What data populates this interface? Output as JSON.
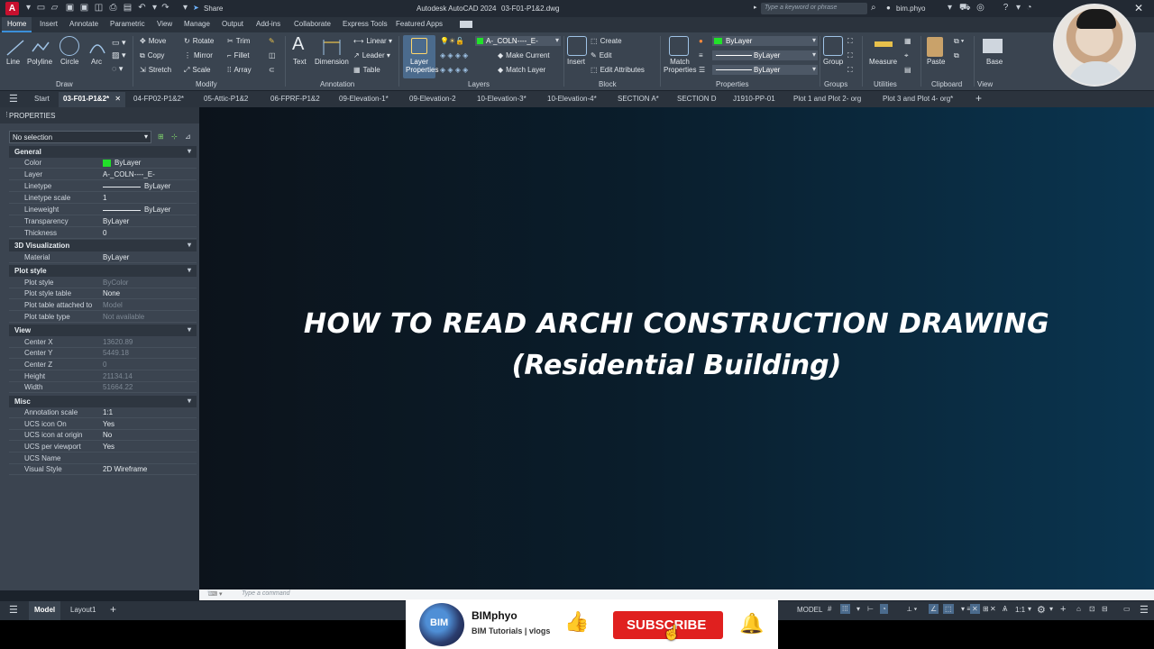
{
  "titlebar": {
    "share_label": "Share",
    "app_title": "Autodesk AutoCAD 2024",
    "file_name": "03-F01-P1&2.dwg",
    "search_placeholder": "Type a keyword or phrase",
    "user": "bim.phyo"
  },
  "ribbon_tabs": [
    "Home",
    "Insert",
    "Annotate",
    "Parametric",
    "View",
    "Manage",
    "Output",
    "Add-ins",
    "Collaborate",
    "Express Tools",
    "Featured Apps"
  ],
  "ribbon": {
    "draw": {
      "line": "Line",
      "polyline": "Polyline",
      "circle": "Circle",
      "arc": "Arc",
      "label": "Draw"
    },
    "modify": {
      "move": "Move",
      "rotate": "Rotate",
      "trim": "Trim",
      "copy": "Copy",
      "mirror": "Mirror",
      "fillet": "Fillet",
      "stretch": "Stretch",
      "scale": "Scale",
      "array": "Array",
      "label": "Modify"
    },
    "annotation": {
      "text": "Text",
      "dimension": "Dimension",
      "linear": "Linear",
      "leader": "Leader",
      "table": "Table",
      "label": "Annotation"
    },
    "layers": {
      "layer_properties": "Layer Properties",
      "current_layer": "A-_COLN----_E-",
      "make_current": "Make Current",
      "match_layer": "Match Layer",
      "label": "Layers"
    },
    "block": {
      "insert": "Insert",
      "create": "Create",
      "edit": "Edit",
      "edit_attributes": "Edit Attributes",
      "label": "Block"
    },
    "properties": {
      "match": "Match Properties",
      "color": "ByLayer",
      "lineweight": "ByLayer",
      "linetype": "ByLayer",
      "label": "Properties"
    },
    "groups": {
      "group": "Group",
      "label": "Groups"
    },
    "utilities": {
      "measure": "Measure",
      "label": "Utilities"
    },
    "clipboard": {
      "paste": "Paste",
      "label": "Clipboard"
    },
    "view": {
      "base": "Base",
      "label": "View"
    }
  },
  "doc_tabs": [
    "Start",
    "03-F01-P1&2*",
    "04-FP02-P1&2*",
    "05-Attic-P1&2",
    "06-FPRF-P1&2",
    "09-Elevation-1*",
    "09-Elevation-2",
    "10-Elevation-3*",
    "10-Elevation-4*",
    "SECTION A*",
    "SECTION D",
    "J1910-PP-01",
    "Plot 1 and Plot 2- org",
    "Plot 3 and Plot 4- org*"
  ],
  "properties_panel": {
    "header": "PROPERTIES",
    "selection": "No selection",
    "general": {
      "title": "General",
      "rows": [
        {
          "label": "Color",
          "value": "ByLayer"
        },
        {
          "label": "Layer",
          "value": "A-_COLN----_E-"
        },
        {
          "label": "Linetype",
          "value": "ByLayer"
        },
        {
          "label": "Linetype scale",
          "value": "1"
        },
        {
          "label": "Lineweight",
          "value": "ByLayer"
        },
        {
          "label": "Transparency",
          "value": "ByLayer"
        },
        {
          "label": "Thickness",
          "value": "0"
        }
      ]
    },
    "viz": {
      "title": "3D Visualization",
      "rows": [
        {
          "label": "Material",
          "value": "ByLayer"
        }
      ]
    },
    "plot": {
      "title": "Plot style",
      "rows": [
        {
          "label": "Plot style",
          "value": "ByColor"
        },
        {
          "label": "Plot style table",
          "value": "None"
        },
        {
          "label": "Plot table attached to",
          "value": "Model"
        },
        {
          "label": "Plot table type",
          "value": "Not available"
        }
      ]
    },
    "view": {
      "title": "View",
      "rows": [
        {
          "label": "Center X",
          "value": "13620.89"
        },
        {
          "label": "Center Y",
          "value": "5449.18"
        },
        {
          "label": "Center Z",
          "value": "0"
        },
        {
          "label": "Height",
          "value": "21134.14"
        },
        {
          "label": "Width",
          "value": "51664.22"
        }
      ]
    },
    "misc": {
      "title": "Misc",
      "rows": [
        {
          "label": "Annotation scale",
          "value": "1:1"
        },
        {
          "label": "UCS icon On",
          "value": "Yes"
        },
        {
          "label": "UCS icon at origin",
          "value": "No"
        },
        {
          "label": "UCS per viewport",
          "value": "Yes"
        },
        {
          "label": "UCS Name",
          "value": ""
        },
        {
          "label": "Visual Style",
          "value": "2D Wireframe"
        }
      ]
    }
  },
  "canvas": {
    "title_line1": "HOW TO READ ARCHI CONSTRUCTION DRAWING",
    "title_line2": "(Residential Building)"
  },
  "command_line": {
    "placeholder": "Type a command"
  },
  "status": {
    "model_tab": "Model",
    "layout_tab": "Layout1",
    "model_indicator": "MODEL",
    "scale": "1:1"
  },
  "subscribe_banner": {
    "channel": "BIMphyo",
    "tagline": "BIM Tutorials | vlogs",
    "button": "SUBSCRIBE",
    "logo_text": "BIM"
  },
  "colors": {
    "accent": "#3b8fd9",
    "subscribe_red": "#e0201f",
    "color_swatch": "#22e02a"
  }
}
